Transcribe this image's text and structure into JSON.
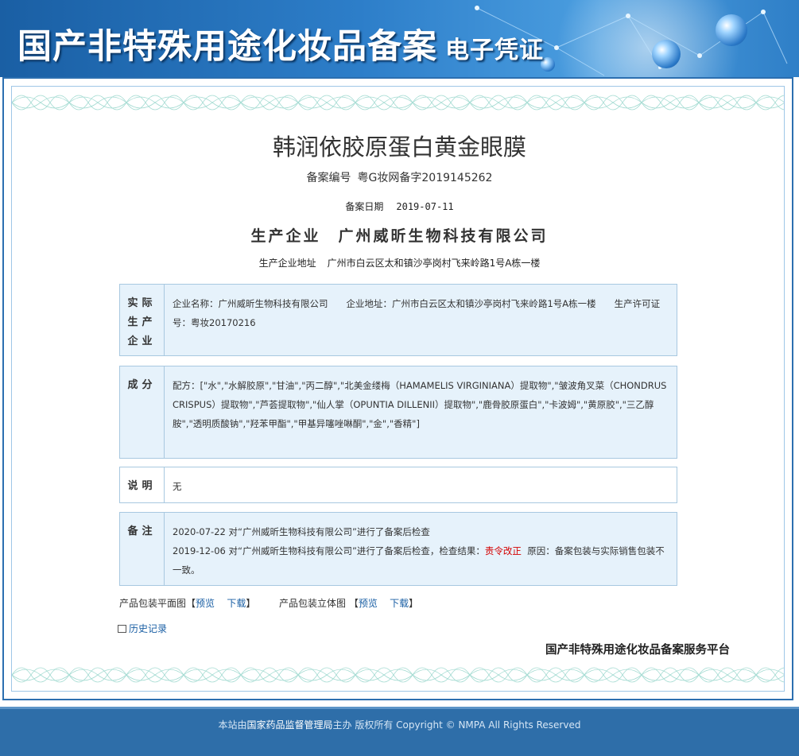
{
  "banner": {
    "title": "国产非特殊用途化妆品备案",
    "subtitle": "电子凭证"
  },
  "product": {
    "name": "韩润依胶原蛋白黄金眼膜",
    "reg_no_label": "备案编号",
    "reg_no": "粤G妆网备字2019145262",
    "reg_date_label": "备案日期",
    "reg_date": "2019-07-11",
    "producer_label": "生产企业",
    "producer": "广州威昕生物科技有限公司",
    "address_label": "生产企业地址",
    "address": "广州市白云区太和镇沙亭岗村飞来岭路1号A栋一楼"
  },
  "sections": {
    "actual_producer": {
      "label": "实际生产企业",
      "label_line1": "实际",
      "label_line2": "生产",
      "label_line3": "企业",
      "text": "企业名称：广州威昕生物科技有限公司　　企业地址：广州市白云区太和镇沙亭岗村飞来岭路1号A栋一楼　　生产许可证号：粤妆20170216"
    },
    "ingredients": {
      "label": "成分",
      "text": "配方：[\"水\",\"水解胶原\",\"甘油\",\"丙二醇\",\"北美金缕梅（HAMAMELIS VIRGINIANA）提取物\",\"皱波角叉菜（CHONDRUS CRISPUS）提取物\",\"芦荟提取物\",\"仙人掌（OPUNTIA DILLENII）提取物\",\"鹿骨胶原蛋白\",\"卡波姆\",\"黄原胶\",\"三乙醇胺\",\"透明质酸钠\",\"羟苯甲酯\",\"甲基异噻唑啉酮\",\"金\",\"香精\"]"
    },
    "description": {
      "label": "说明",
      "text": "无"
    },
    "remarks": {
      "label": "备注",
      "line1": "2020-07-22 对“广州威昕生物科技有限公司”进行了备案后检查",
      "line2_prefix": "2019-12-06 对“广州威昕生物科技有限公司”进行了备案后检查，检查结果：",
      "line2_result": "责令改正",
      "line2_suffix": "原因：备案包装与实际销售包装不一致。"
    }
  },
  "links": {
    "flat_label": "产品包装平面图",
    "solid_label": "产品包装立体图",
    "bracket_open": "【",
    "bracket_close": "】",
    "preview": "预览",
    "download": "下载",
    "history": "历史记录"
  },
  "platform": "国产非特殊用途化妆品备案服务平台",
  "footer": {
    "prefix": "本站由",
    "org": "国家药品监督管理局",
    "suffix": "主办 版权所有 Copyright © NMPA All Rights Reserved"
  },
  "colors": {
    "banner_blue": "#1a5fa4",
    "frame_blue": "#2c6fb0",
    "box_bg": "#e6f2fb",
    "warning_red": "#d40000",
    "footer_blue": "#2e6ea9"
  }
}
